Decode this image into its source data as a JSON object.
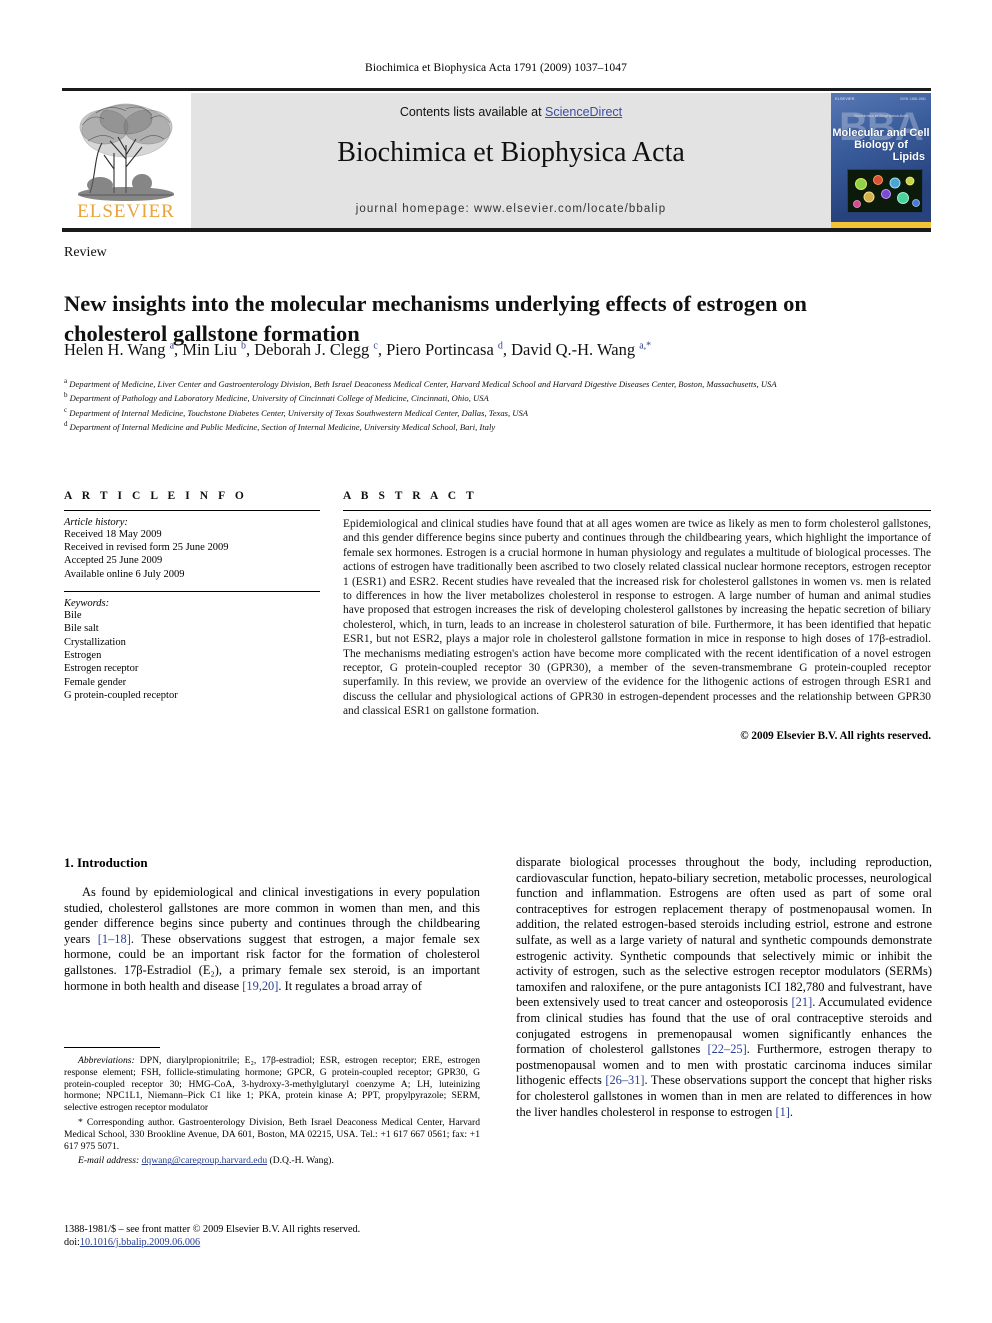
{
  "running_head": "Biochimica et Biophysica Acta 1791 (2009) 1037–1047",
  "masthead": {
    "contents_prefix": "Contents lists available at ",
    "sciencedirect": "ScienceDirect",
    "journal_title": "Biochimica et Biophysica Acta",
    "homepage": "journal homepage: www.elsevier.com/locate/bbalip",
    "publisher_logo_text": "ELSEVIER",
    "publisher_logo_color": "#E8A33D"
  },
  "cover": {
    "watermark": "BBA",
    "top_left_label": "ELSEVIER",
    "top_right_label": "ISSN 1388-1981",
    "series_label": "Biochimica et Biophysica Acta",
    "title_line1": "Molecular and",
    "title_line2": "Cell Biology of",
    "title_line3": "Lipids",
    "background_color": "#2c4a86",
    "accent_color": "#F3C237"
  },
  "article_type": "Review",
  "title": "New insights into the molecular mechanisms underlying effects of estrogen on cholesterol gallstone formation",
  "authors_html": "Helen H. Wang <sup>a</sup>, Min Liu <sup>b</sup>, Deborah J. Clegg <sup>c</sup>, Piero Portincasa <sup>d</sup>, David Q.-H. Wang <sup>a,*</sup>",
  "affiliations": [
    {
      "marker": "a",
      "text": "Department of Medicine, Liver Center and Gastroenterology Division, Beth Israel Deaconess Medical Center, Harvard Medical School and Harvard Digestive Diseases Center, Boston, Massachusetts, USA"
    },
    {
      "marker": "b",
      "text": "Department of Pathology and Laboratory Medicine, University of Cincinnati College of Medicine, Cincinnati, Ohio, USA"
    },
    {
      "marker": "c",
      "text": "Department of Internal Medicine, Touchstone Diabetes Center, University of Texas Southwestern Medical Center, Dallas, Texas, USA"
    },
    {
      "marker": "d",
      "text": "Department of Internal Medicine and Public Medicine, Section of Internal Medicine, University Medical School, Bari, Italy"
    }
  ],
  "article_info": {
    "heading": "A R T I C L E    I N F O",
    "history_label": "Article history:",
    "history": [
      "Received 18 May 2009",
      "Received in revised form 25 June 2009",
      "Accepted 25 June 2009",
      "Available online 6 July 2009"
    ],
    "keywords_label": "Keywords:",
    "keywords": [
      "Bile",
      "Bile salt",
      "Crystallization",
      "Estrogen",
      "Estrogen receptor",
      "Female gender",
      "G protein-coupled receptor"
    ]
  },
  "abstract": {
    "heading": "A B S T R A C T",
    "text": "Epidemiological and clinical studies have found that at all ages women are twice as likely as men to form cholesterol gallstones, and this gender difference begins since puberty and continues through the childbearing years, which highlight the importance of female sex hormones. Estrogen is a crucial hormone in human physiology and regulates a multitude of biological processes. The actions of estrogen have traditionally been ascribed to two closely related classical nuclear hormone receptors, estrogen receptor 1 (ESR1) and ESR2. Recent studies have revealed that the increased risk for cholesterol gallstones in women vs. men is related to differences in how the liver metabolizes cholesterol in response to estrogen. A large number of human and animal studies have proposed that estrogen increases the risk of developing cholesterol gallstones by increasing the hepatic secretion of biliary cholesterol, which, in turn, leads to an increase in cholesterol saturation of bile. Furthermore, it has been identified that hepatic ESR1, but not ESR2, plays a major role in cholesterol gallstone formation in mice in response to high doses of 17β-estradiol. The mechanisms mediating estrogen's action have become more complicated with the recent identification of a novel estrogen receptor, G protein-coupled receptor 30 (GPR30), a member of the seven-transmembrane G protein-coupled receptor superfamily. In this review, we provide an overview of the evidence for the lithogenic actions of estrogen through ESR1 and discuss the cellular and physiological actions of GPR30 in estrogen-dependent processes and the relationship between GPR30 and classical ESR1 on gallstone formation.",
    "copyright": "© 2009 Elsevier B.V. All rights reserved."
  },
  "introduction": {
    "heading": "1. Introduction",
    "left_paragraph_part1": "As found by epidemiological and clinical investigations in every population studied, cholesterol gallstones are more common in women than men, and this gender difference begins since puberty and continues through the childbearing years ",
    "left_cite1": "[1–18]",
    "left_paragraph_part2": ". These observations suggest that estrogen, a major female sex hormone, could be an important risk factor for the formation of cholesterol gallstones. 17β-Estradiol (E₂), a primary female sex steroid, is an important hormone in both health and disease ",
    "left_cite2": "[19,20]",
    "left_paragraph_part3": ". It regulates a broad array of",
    "right_part1": "disparate biological processes throughout the body, including reproduction, cardiovascular function, hepato-biliary secretion, metabolic processes, neurological function and inflammation. Estrogens are often used as part of some oral contraceptives for estrogen replacement therapy of postmenopausal women. In addition, the related estrogen-based steroids including estriol, estrone and estrone sulfate, as well as a large variety of natural and synthetic compounds demonstrate estrogenic activity. Synthetic compounds that selectively mimic or inhibit the activity of estrogen, such as the selective estrogen receptor modulators (SERMs) tamoxifen and raloxifene, or the pure antagonists ICI 182,780 and fulvestrant, have been extensively used to treat cancer and osteoporosis ",
    "right_cite1": "[21]",
    "right_part2": ". Accumulated evidence from clinical studies has found that the use of oral contraceptive steroids and conjugated estrogens in premenopausal women significantly enhances the formation of cholesterol gallstones ",
    "right_cite2": "[22–25]",
    "right_part3": ". Furthermore, estrogen therapy to postmenopausal women and to men with prostatic carcinoma induces similar lithogenic effects ",
    "right_cite3": "[26–31]",
    "right_part4": ". These observations support the concept that higher risks for cholesterol gallstones in women than in men are related to differences in how the liver handles cholesterol in response to estrogen ",
    "right_cite4": "[1]",
    "right_part5": "."
  },
  "footnotes": {
    "abbreviations_label": "Abbreviations:",
    "abbreviations_text": " DPN, diarylpropionitrile; E₂, 17β-estradiol; ESR, estrogen receptor; ERE, estrogen response element; FSH, follicle-stimulating hormone; GPCR, G protein-coupled receptor; GPR30, G protein-coupled receptor 30; HMG-CoA, 3-hydroxy-3-methylglutaryl coenzyme A; LH, luteinizing hormone; NPC1L1, Niemann–Pick C1 like 1; PKA, protein kinase A; PPT, propylpyrazole; SERM, selective estrogen receptor modulator",
    "corresponding_author": "* Corresponding author. Gastroenterology Division, Beth Israel Deaconess Medical Center, Harvard Medical School, 330 Brookline Avenue, DA 601, Boston, MA 02215, USA. Tel.: +1 617 667 0561; fax: +1 617 975 5071.",
    "email_label": "E-mail address:",
    "email": "dqwang@caregroup.harvard.edu",
    "email_suffix": " (D.Q.-H. Wang)."
  },
  "footer": {
    "issn_line": "1388-1981/$ – see front matter © 2009 Elsevier B.V. All rights reserved.",
    "doi_label": "doi:",
    "doi": "10.1016/j.bbalip.2009.06.006"
  }
}
